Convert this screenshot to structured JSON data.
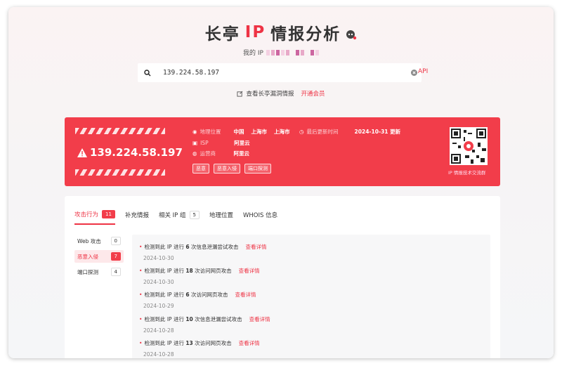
{
  "header": {
    "title_pre": "长亭",
    "title_ip": "IP",
    "title_post": "情报分析",
    "myip_label": "我的 IP"
  },
  "search": {
    "value": "139.224.58.197",
    "api_label": "API",
    "vuln_link": "查看长亭漏洞情报",
    "member_link": "开通会员"
  },
  "card": {
    "ip": "139.224.58.197",
    "geo_label": "地理位置",
    "geo_values": [
      "中国",
      "上海市",
      "上海市"
    ],
    "isp_label": "ISP",
    "isp_value": "阿里云",
    "operator_label": "运营商",
    "operator_value": "阿里云",
    "updated_label": "最后更新时间",
    "updated_value": "2024-10-31 更新",
    "tags": [
      "恶意",
      "恶意入侵",
      "端口探测"
    ],
    "qr_label": "IP 情报技术交流群"
  },
  "tabs": [
    {
      "label": "攻击行为",
      "count": "11"
    },
    {
      "label": "补充情报",
      "count": ""
    },
    {
      "label": "相关 IP 组",
      "count": "5"
    },
    {
      "label": "地理位置",
      "count": ""
    },
    {
      "label": "WHOIS 信息",
      "count": ""
    }
  ],
  "side": [
    {
      "label": "Web 攻击",
      "count": "0"
    },
    {
      "label": "恶意入侵",
      "count": "7"
    },
    {
      "label": "端口探测",
      "count": "4"
    }
  ],
  "events": [
    {
      "pre": "检测到此 IP 进行",
      "num": "6",
      "post": "次信息泄漏尝试攻击",
      "link": "查看详情",
      "date": "2024-10-30"
    },
    {
      "pre": "检测到此 IP 进行",
      "num": "18",
      "post": "次访问网页攻击",
      "link": "查看详情",
      "date": "2024-10-30"
    },
    {
      "pre": "检测到此 IP 进行",
      "num": "6",
      "post": "次访问网页攻击",
      "link": "查看详情",
      "date": "2024-10-29"
    },
    {
      "pre": "检测到此 IP 进行",
      "num": "10",
      "post": "次信息泄漏尝试攻击",
      "link": "查看详情",
      "date": "2024-10-28"
    },
    {
      "pre": "检测到此 IP 进行",
      "num": "13",
      "post": "次访问网页攻击",
      "link": "查看详情",
      "date": "2024-10-28"
    }
  ],
  "colors": {
    "accent": "#f23d4a"
  }
}
